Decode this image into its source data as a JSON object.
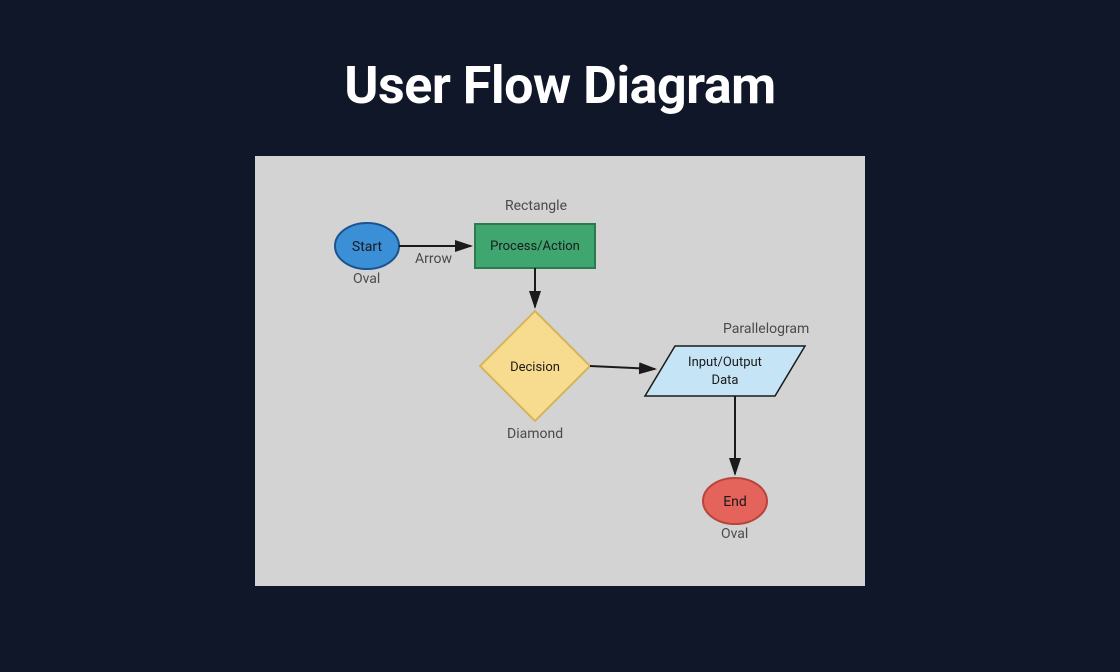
{
  "title": "User Flow Diagram",
  "nodes": {
    "start": {
      "text": "Start",
      "shape_label": "Oval"
    },
    "process": {
      "text": "Process/Action",
      "shape_label": "Rectangle"
    },
    "decision": {
      "text": "Decision",
      "shape_label": "Diamond"
    },
    "io": {
      "text1": "Input/Output",
      "text2": "Data",
      "shape_label": "Parallelogram"
    },
    "end": {
      "text": "End",
      "shape_label": "Oval"
    }
  },
  "arrows": {
    "start_to_process": {
      "label": "Arrow"
    }
  },
  "colors": {
    "start_fill": "#3b8fd6",
    "start_stroke": "#1a5490",
    "process_fill": "#3fa66f",
    "process_stroke": "#2c7a4f",
    "decision_fill": "#f7dc8f",
    "decision_stroke": "#d4b55c",
    "io_fill": "#c5e4f5",
    "io_stroke": "#1a1a1a",
    "end_fill": "#e4635a",
    "end_stroke": "#b8453c"
  }
}
